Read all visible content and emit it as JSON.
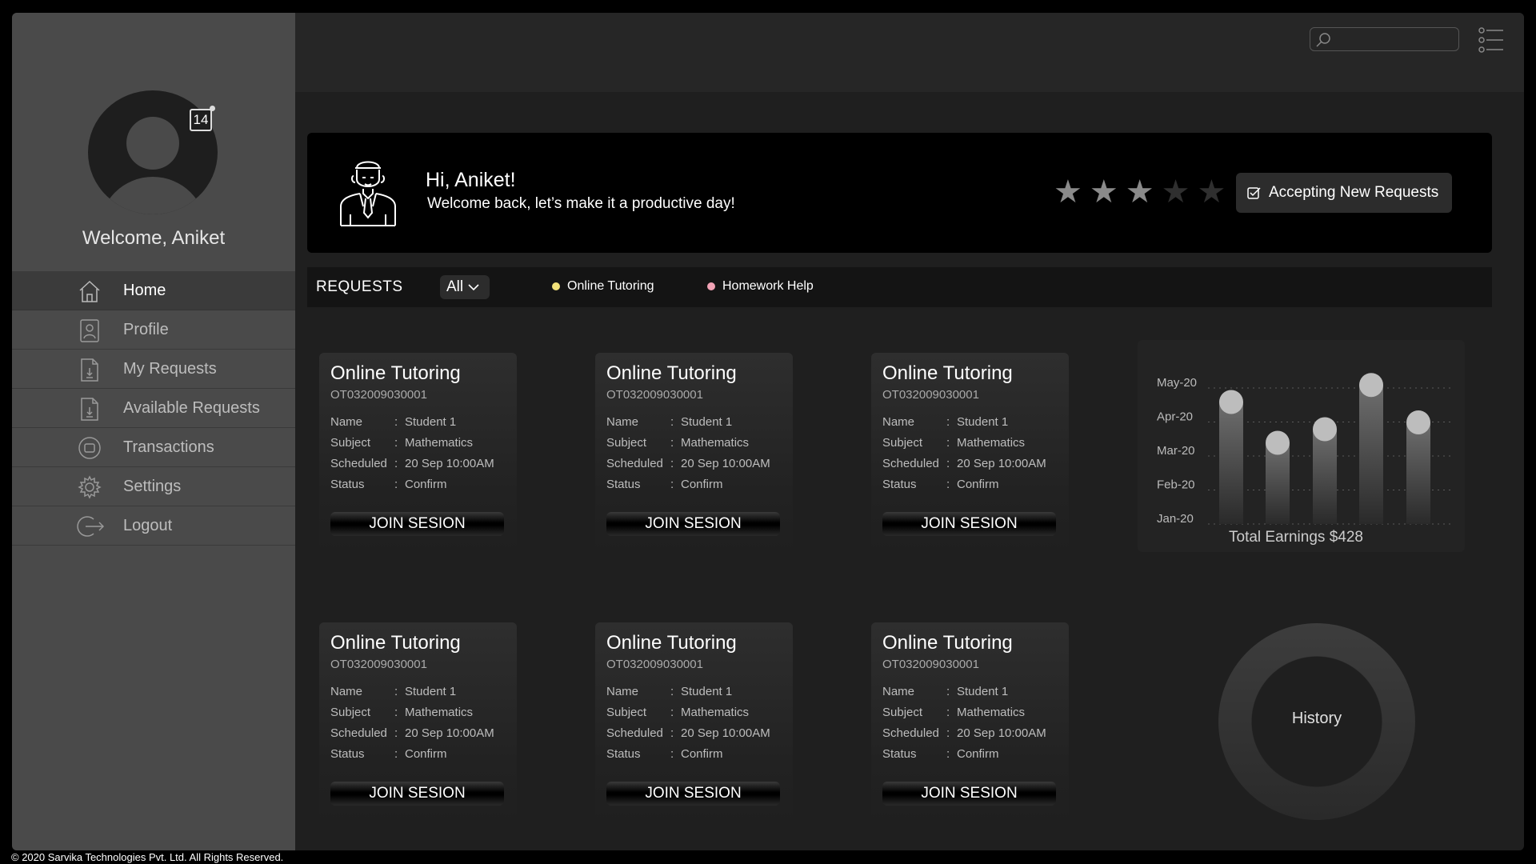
{
  "profile": {
    "notification_count": "14",
    "welcome": "Welcome, Aniket"
  },
  "nav": {
    "items": [
      {
        "label": "Home",
        "icon": "home-icon",
        "active": true
      },
      {
        "label": "Profile",
        "icon": "profile-icon"
      },
      {
        "label": "My Requests",
        "icon": "document-icon"
      },
      {
        "label": "Available Requests",
        "icon": "document-icon"
      },
      {
        "label": "Transactions",
        "icon": "transactions-icon"
      },
      {
        "label": "Settings",
        "icon": "gear-icon"
      },
      {
        "label": "Logout",
        "icon": "logout-icon"
      }
    ]
  },
  "banner": {
    "greeting": "Hi, Aniket!",
    "message": "Welcome back, let’s make it a productive day!",
    "rating": 3,
    "rating_max": 5,
    "accept_label": "Accepting New Requests"
  },
  "requests": {
    "title": "REQUESTS",
    "filter_value": "All",
    "legend": [
      {
        "label": "Online Tutoring",
        "color": "#f2e27a"
      },
      {
        "label": "Homework Help",
        "color": "#f2a3b6"
      }
    ]
  },
  "cards": [
    {
      "title": "Online Tutoring",
      "id": "OT032009030001",
      "name": "Student 1",
      "subject": "Mathematics",
      "scheduled": "20 Sep 10:00AM",
      "status": "Confirm",
      "button": "JOIN SESION"
    },
    {
      "title": "Online Tutoring",
      "id": "OT032009030001",
      "name": "Student 1",
      "subject": "Mathematics",
      "scheduled": "20 Sep 10:00AM",
      "status": "Confirm",
      "button": "JOIN SESION"
    },
    {
      "title": "Online Tutoring",
      "id": "OT032009030001",
      "name": "Student 1",
      "subject": "Mathematics",
      "scheduled": "20 Sep 10:00AM",
      "status": "Confirm",
      "button": "JOIN SESION"
    },
    {
      "title": "Online Tutoring",
      "id": "OT032009030001",
      "name": "Student 1",
      "subject": "Mathematics",
      "scheduled": "20 Sep 10:00AM",
      "status": "Confirm",
      "button": "JOIN SESION"
    },
    {
      "title": "Online Tutoring",
      "id": "OT032009030001",
      "name": "Student 1",
      "subject": "Mathematics",
      "scheduled": "20 Sep 10:00AM",
      "status": "Confirm",
      "button": "JOIN SESION"
    },
    {
      "title": "Online Tutoring",
      "id": "OT032009030001",
      "name": "Student 1",
      "subject": "Mathematics",
      "scheduled": "20 Sep 10:00AM",
      "status": "Confirm",
      "button": "JOIN SESION"
    }
  ],
  "card_labels": {
    "name": "Name",
    "subject": "Subject",
    "scheduled": "Scheduled",
    "status": "Status",
    "sep": ":"
  },
  "chart_data": {
    "type": "bar",
    "y_categories": [
      "Jan-20",
      "Feb-20",
      "Mar-20",
      "Apr-20",
      "May-20"
    ],
    "values": [
      3.4,
      2.2,
      2.6,
      3.9,
      2.8
    ],
    "caption": "Total Earnings $428",
    "grid": true
  },
  "history": {
    "label": "History"
  },
  "footer": {
    "text": "© 2020 Sarvika Technologies  Pvt. Ltd. All Rights Reserved."
  }
}
